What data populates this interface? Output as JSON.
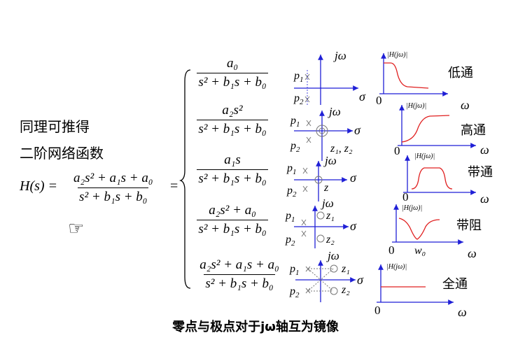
{
  "intro": {
    "line1": "同理可推得",
    "line2": "二阶网络函数"
  },
  "main_formula": {
    "lhs": "H(s) =",
    "numerator": "a₂s² + a₁s + a₀",
    "denominator": "s² + b₁s + b₀",
    "equals": "="
  },
  "pointer_icon": "pointing-hand-icon",
  "cases": [
    {
      "numerator": "a₀",
      "denominator": "s² + b₁s + b₀",
      "filter": "低通"
    },
    {
      "numerator": "a₂s²",
      "denominator": "s² + b₁s + b₀",
      "filter": "高通"
    },
    {
      "numerator": "a₁s",
      "denominator": "s² + b₁s + b₀",
      "filter": "带通"
    },
    {
      "numerator": "a₂s² + a₀",
      "denominator": "s² + b₁s + b₀",
      "filter": "带阻"
    },
    {
      "numerator": "a₂s² + a₁s + a₀",
      "denominator": "s² + b₁s + b₀",
      "filter": "全通"
    }
  ],
  "pz_labels": {
    "jw": "jω",
    "sigma": "σ",
    "p1": "p",
    "p2": "p",
    "sub1": "1",
    "sub2": "2",
    "z12": "z₁, z₂",
    "z": "z",
    "z1": "z₁",
    "z2": "z₂"
  },
  "response_labels": {
    "H": "|H(jω)|",
    "omega": "ω",
    "zero": "0",
    "w0": "w₀"
  },
  "caption": "零点与极点对于jω轴互为镜像",
  "colors": {
    "axis": "#1f1fd6",
    "response": "#e02020",
    "marker": "#777777"
  }
}
